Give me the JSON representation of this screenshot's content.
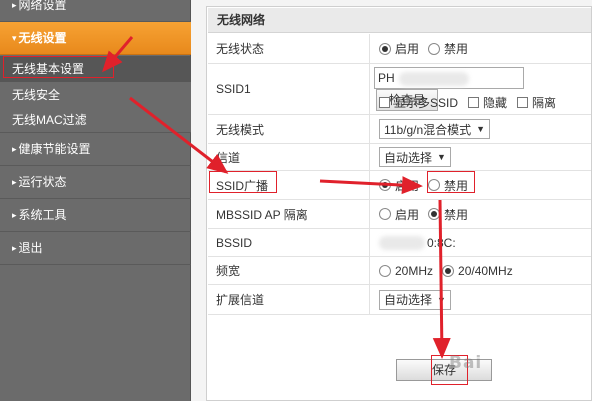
{
  "sidebar": {
    "items": [
      {
        "label": "网络设置",
        "active": false
      },
      {
        "label": "无线设置",
        "active": true
      },
      {
        "label": "健康节能设置",
        "active": false
      },
      {
        "label": "运行状态",
        "active": false
      },
      {
        "label": "系统工具",
        "active": false
      },
      {
        "label": "退出",
        "active": false
      }
    ],
    "sub_items": [
      {
        "label": "无线基本设置",
        "active": true
      },
      {
        "label": "无线安全",
        "active": false
      },
      {
        "label": "无线MAC过滤",
        "active": false
      }
    ]
  },
  "panel": {
    "title": "无线网络",
    "wireless_status": {
      "label": "无线状态",
      "on": "启用",
      "off": "禁用",
      "selected": "启用"
    },
    "ssid1": {
      "label": "SSID1",
      "value_prefix": "PH",
      "check_button": "检查是",
      "opt_show_multi": "显示多SSID",
      "opt_hide": "隐藏",
      "opt_isolate": "隔离"
    },
    "wireless_mode": {
      "label": "无线模式",
      "value": "11b/g/n混合模式"
    },
    "channel": {
      "label": "信道",
      "value": "自动选择"
    },
    "ssid_broadcast": {
      "label": "SSID广播",
      "on": "启用",
      "off": "禁用",
      "selected": "启用"
    },
    "mbssid_isolation": {
      "label": "MBSSID AP 隔离",
      "on": "启用",
      "off": "禁用",
      "selected": "禁用"
    },
    "bssid": {
      "label": "BSSID",
      "value_suffix": "0:8C:"
    },
    "bandwidth": {
      "label": "频宽",
      "opt1": "20MHz",
      "opt2": "20/40MHz",
      "selected": "20/40MHz"
    },
    "ext_channel": {
      "label": "扩展信道",
      "value": "自动选择"
    },
    "save_button": "保存"
  },
  "watermark": "Bai"
}
